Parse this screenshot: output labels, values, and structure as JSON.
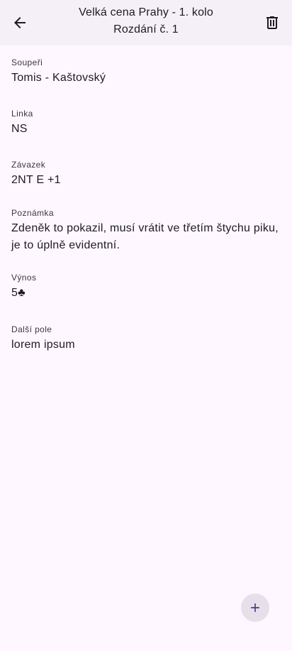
{
  "header": {
    "title": "Velká cena Prahy - 1. kolo",
    "subtitle": "Rozdání č. 1",
    "back_icon": "arrow-back-icon",
    "delete_icon": "trash-icon"
  },
  "fields": [
    {
      "label": "Soupeři",
      "value": "Tomis - Kaštovský"
    },
    {
      "label": "Linka",
      "value": "NS"
    },
    {
      "label": "Závazek",
      "value": "2NT E +1"
    },
    {
      "label": "Poznámka",
      "value": "Zdeněk to pokazil, musí vrátit ve třetím štychu piku, je to úplně evidentní."
    },
    {
      "label": "Výnos",
      "value": "5♣"
    },
    {
      "label": "Další pole",
      "value": "lorem ipsum"
    }
  ],
  "fab": {
    "icon": "plus-icon"
  },
  "colors": {
    "background": "#fef7ff",
    "appbar": "#f5f0f7",
    "fab": "#e6e0ea",
    "fab_icon": "#4f378b"
  }
}
